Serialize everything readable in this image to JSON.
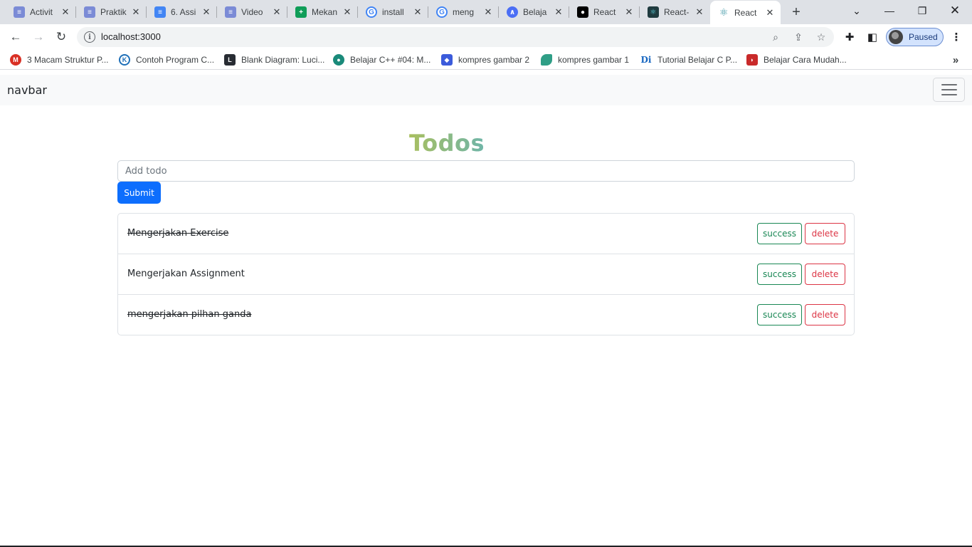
{
  "browser": {
    "tabs": [
      {
        "title": "Activit",
        "icon": "activity-icon",
        "color": "#7b8bd6"
      },
      {
        "title": "Praktik",
        "icon": "dicoding-icon",
        "color": "#7b8bd6"
      },
      {
        "title": "6. Assi",
        "icon": "google-docs-icon",
        "color": "#4285f4"
      },
      {
        "title": "Video",
        "icon": "dicoding-icon",
        "color": "#7b8bd6"
      },
      {
        "title": "Mekan",
        "icon": "google-sheets-icon",
        "color": "#0f9d58"
      },
      {
        "title": "install",
        "icon": "google-icon",
        "color": "#4285f4"
      },
      {
        "title": "meng",
        "icon": "google-icon",
        "color": "#4285f4"
      },
      {
        "title": "Belaja",
        "icon": "belajar-icon",
        "color": "#4b6ef5"
      },
      {
        "title": "React",
        "icon": "medium-icon",
        "color": "#000000"
      },
      {
        "title": "React-",
        "icon": "react-router-icon",
        "color": "#1f3b3f"
      },
      {
        "title": "React",
        "icon": "react-icon",
        "color": "#2a8c9c",
        "active": true
      }
    ],
    "url": "localhost:3000",
    "profile_label": "Paused",
    "bookmarks": [
      {
        "label": "3 Macam Struktur P...",
        "icon": "md-icon",
        "color": "#d93025"
      },
      {
        "label": "Contoh Program C...",
        "icon": "k-icon",
        "color": "#1e6fb8"
      },
      {
        "label": "Blank Diagram: Luci...",
        "icon": "lucid-icon",
        "color": "#282c33"
      },
      {
        "label": "Belajar C++ #04: M...",
        "icon": "petani-kode-icon",
        "color": "#1a8a7a"
      },
      {
        "label": "kompres gambar 2",
        "icon": "compress-icon",
        "color": "#3b5bdb"
      },
      {
        "label": "kompres gambar 1",
        "icon": "leaf-icon",
        "color": "#2f9e86"
      },
      {
        "label": "Tutorial Belajar C P...",
        "icon": "di-icon",
        "color": "#1565c0"
      },
      {
        "label": "Belajar Cara Mudah...",
        "icon": "flag-icon",
        "color": "#c92a2a"
      }
    ]
  },
  "app": {
    "brand": "navbar",
    "heading": "Todos",
    "input_placeholder": "Add todo",
    "submit_label": "Submit",
    "todos": [
      {
        "text": "Mengerjakan Exercise",
        "done": true,
        "success_label": "success",
        "delete_label": "delete"
      },
      {
        "text": "Mengerjakan Assignment",
        "done": false,
        "success_label": "success",
        "delete_label": "delete"
      },
      {
        "text": "mengerjakan pilhan ganda",
        "done": true,
        "success_label": "success",
        "delete_label": "delete"
      }
    ]
  },
  "colors": {
    "primary": "#0d6efd",
    "success": "#198754",
    "danger": "#dc3545",
    "heading": "#8fbf6e"
  }
}
